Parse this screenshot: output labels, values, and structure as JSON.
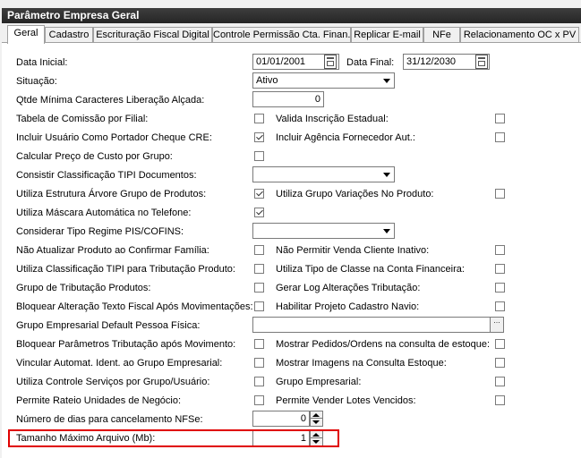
{
  "window": {
    "title": "Parâmetro Empresa Geral"
  },
  "tabs": [
    {
      "label": "Geral"
    },
    {
      "label": "Cadastro"
    },
    {
      "label": "Escrituração Fiscal Digital"
    },
    {
      "label": "Controle Permissão Cta. Finan."
    },
    {
      "label": "Replicar E-mail"
    },
    {
      "label": "NFe"
    },
    {
      "label": "Relacionamento OC x PV"
    }
  ],
  "fields": {
    "data_inicial_label": "Data Inicial:",
    "data_inicial_value": "01/01/2001",
    "data_final_label": "Data Final:",
    "data_final_value": "31/12/2030",
    "situacao_label": "Situação:",
    "situacao_value": "Ativo",
    "qtde_label": "Qtde Mínima Caracteres Liberação Alçada:",
    "qtde_value": "0",
    "tabela_comissao_label": "Tabela de Comissão por Filial:",
    "valida_ie_label": "Valida Inscrição Estadual:",
    "incluir_usuario_label": "Incluir Usuário Como Portador Cheque CRE:",
    "incluir_agencia_label": "Incluir Agência Fornecedor Aut.:",
    "calcular_preco_label": "Calcular Preço de Custo por Grupo:",
    "consistir_tipi_label": "Consistir Classificação TIPI Documentos:",
    "consistir_tipi_value": "",
    "utiliza_estrutura_label": "Utiliza Estrutura Árvore Grupo de Produtos:",
    "utiliza_grupo_var_label": "Utiliza Grupo Variações No Produto:",
    "utiliza_mascara_label": "Utiliza Máscara Automática no Telefone:",
    "considerar_pis_label": "Considerar Tipo Regime PIS/COFINS:",
    "considerar_pis_value": "",
    "nao_atualizar_label": "Não Atualizar Produto ao Confirmar Família:",
    "nao_permitir_label": "Não Permitir Venda Cliente Inativo:",
    "utiliza_class_tipi_label": "Utiliza Classificação TIPI para Tributação Produto:",
    "utiliza_tipo_classe_label": "Utiliza Tipo de Classe na Conta Financeira:",
    "grupo_trib_label": "Grupo de Tributação Produtos:",
    "gerar_log_label": "Gerar Log Alterações Tributação:",
    "bloquear_alteracao_label": "Bloquear Alteração Texto Fiscal Após Movimentações:",
    "habilitar_navio_label": "Habilitar Projeto Cadastro Navio:",
    "grupo_empresarial_default_label": "Grupo Empresarial Default Pessoa Física:",
    "grupo_empresarial_default_value": "",
    "bloquear_param_label": "Bloquear Parâmetros Tributação após Movimento:",
    "mostrar_pedidos_label": "Mostrar Pedidos/Ordens na consulta de estoque:",
    "vincular_label": "Vincular Automat. Ident. ao Grupo Empresarial:",
    "mostrar_imagens_label": "Mostrar Imagens na Consulta Estoque:",
    "utiliza_controle_label": "Utiliza Controle Serviços por Grupo/Usuário:",
    "grupo_empresarial_label": "Grupo Empresarial:",
    "permite_rateio_label": "Permite Rateio Unidades de Negócio:",
    "permite_lotes_label": "Permite Vender Lotes Vencidos:",
    "numero_dias_label": "Número de dias para cancelamento NFSe:",
    "numero_dias_value": "0",
    "tamanho_label": "Tamanho Máximo Arquivo (Mb):",
    "tamanho_value": "1"
  },
  "checks": {
    "tabela_comissao": false,
    "valida_ie": false,
    "incluir_usuario": true,
    "incluir_agencia": false,
    "calcular_preco": false,
    "utiliza_estrutura": true,
    "utiliza_grupo_var": false,
    "utiliza_mascara": true,
    "nao_atualizar": false,
    "nao_permitir": false,
    "utiliza_class_tipi": false,
    "utiliza_tipo_classe": false,
    "grupo_trib": false,
    "gerar_log": false,
    "bloquear_alteracao": false,
    "habilitar_navio": false,
    "bloquear_param": false,
    "mostrar_pedidos": false,
    "vincular": false,
    "mostrar_imagens": false,
    "utiliza_controle": false,
    "grupo_empresarial": false,
    "permite_rateio": false,
    "permite_lotes": false
  },
  "icons": {
    "lookup_glyph": "…"
  }
}
